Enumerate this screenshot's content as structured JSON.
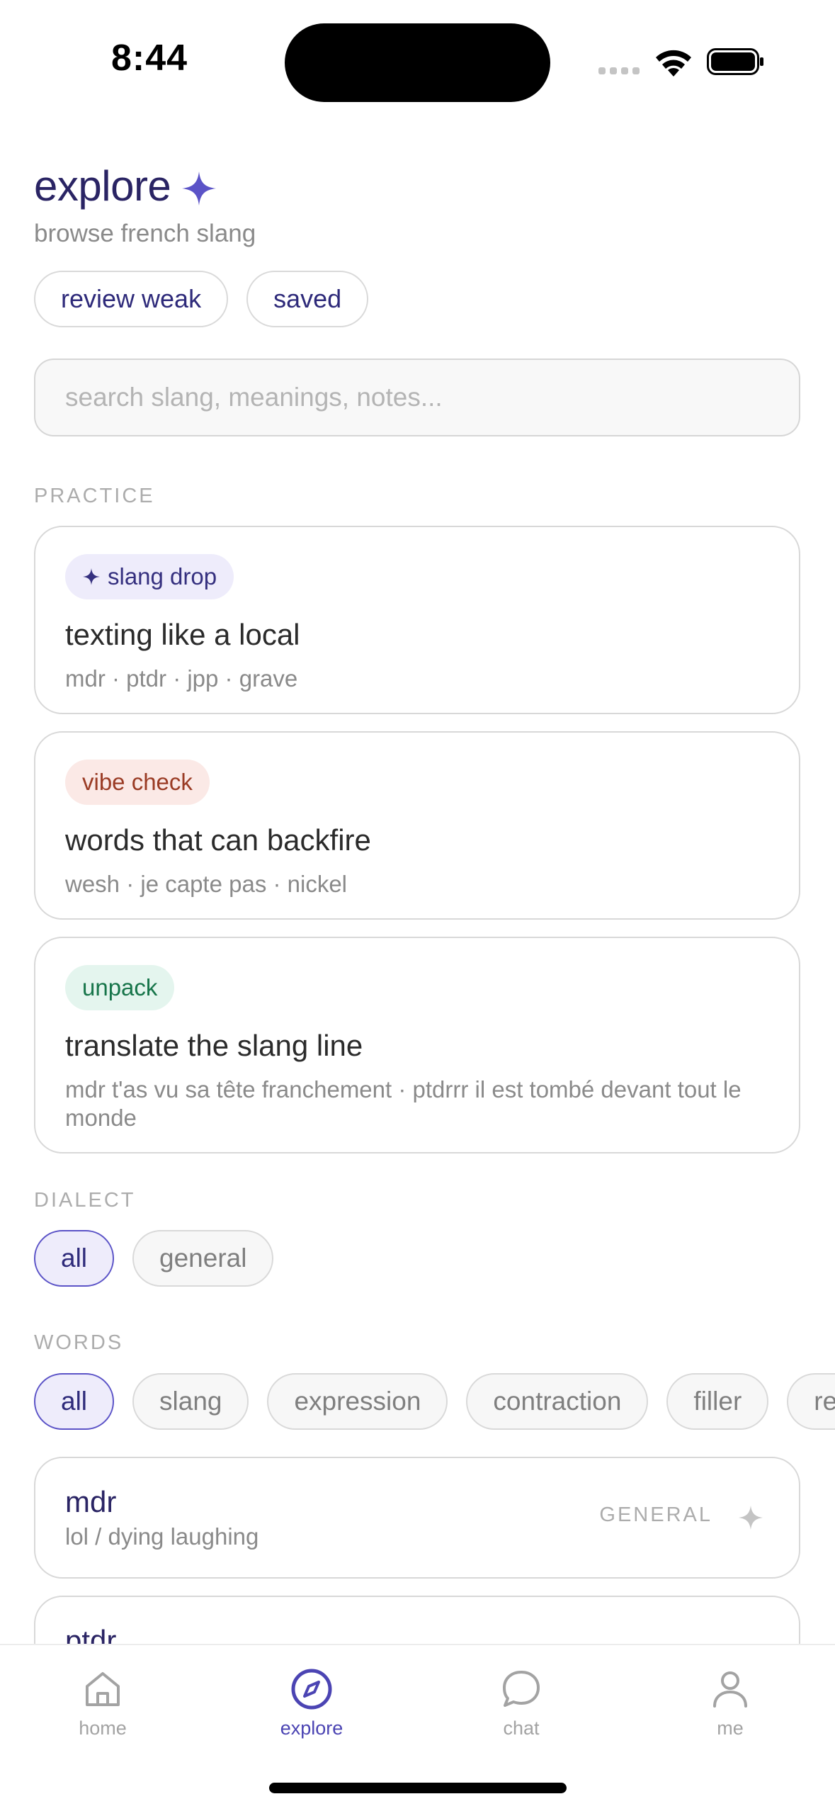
{
  "status_bar": {
    "time": "8:44"
  },
  "header": {
    "title": "explore",
    "subtitle": "browse french slang",
    "chips": [
      "review weak",
      "saved"
    ]
  },
  "search": {
    "placeholder": "search slang, meanings, notes..."
  },
  "practice": {
    "label": "PRACTICE",
    "cards": [
      {
        "tag": "slang drop",
        "title": "texting like a local",
        "subtitle": "mdr · ptdr · jpp · grave"
      },
      {
        "tag": "vibe check",
        "title": "words that can backfire",
        "subtitle": "wesh · je capte pas · nickel"
      },
      {
        "tag": "unpack",
        "title": "translate the slang line",
        "subtitle": "mdr t'as vu sa tête franchement · ptdrrr il est tombé devant tout le monde"
      }
    ]
  },
  "dialect": {
    "label": "DIALECT",
    "options": [
      "all",
      "general"
    ],
    "selected": "all"
  },
  "words": {
    "label": "WORDS",
    "filters": [
      "all",
      "slang",
      "expression",
      "contraction",
      "filler",
      "re"
    ],
    "selected": "all",
    "items": [
      {
        "term": "mdr",
        "meaning": "lol / dying laughing",
        "dialect": "GENERAL"
      },
      {
        "term": "ptdr",
        "meaning": "",
        "dialect": ""
      }
    ]
  },
  "tabbar": {
    "tabs": [
      {
        "label": "home",
        "icon": "home-icon"
      },
      {
        "label": "explore",
        "icon": "compass-icon"
      },
      {
        "label": "chat",
        "icon": "chat-bubble-icon"
      },
      {
        "label": "me",
        "icon": "person-icon"
      }
    ],
    "active": "explore"
  },
  "colors": {
    "accent": "#5b53c7",
    "title": "#2a2464",
    "tag_purple_bg": "#eeecfb",
    "tag_red_bg": "#fbe9e6",
    "tag_green_bg": "#e4f5ee"
  }
}
